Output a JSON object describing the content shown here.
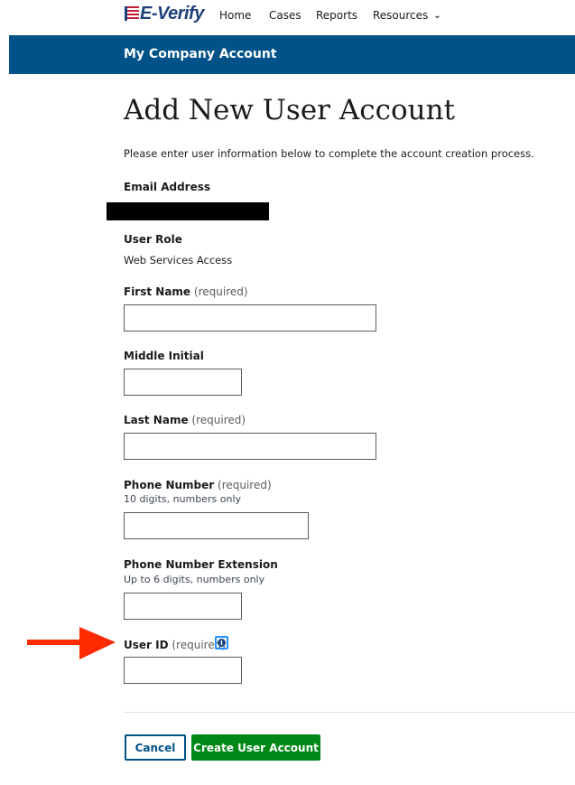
{
  "nav": {
    "logo_text": "E-Verify",
    "items": [
      "Home",
      "Cases",
      "Reports",
      "Resources"
    ]
  },
  "banner": {
    "title": "My Company Account"
  },
  "page": {
    "title": "Add New User Account",
    "intro": "Please enter user information below to complete the account creation process."
  },
  "form": {
    "required_text": "(required)",
    "email": {
      "label": "Email Address"
    },
    "user_role": {
      "label": "User Role",
      "value": "Web Services Access"
    },
    "first_name": {
      "label": "First Name",
      "value": ""
    },
    "middle_initial": {
      "label": "Middle Initial",
      "value": ""
    },
    "last_name": {
      "label": "Last Name",
      "value": ""
    },
    "phone": {
      "label": "Phone Number",
      "hint": "10 digits, numbers only",
      "value": ""
    },
    "phone_ext": {
      "label": "Phone Number Extension",
      "hint": "Up to 6 digits, numbers only",
      "value": ""
    },
    "user_id": {
      "label": "User ID",
      "value": "",
      "info_icon": "info-circle-icon"
    }
  },
  "actions": {
    "cancel_label": "Cancel",
    "create_label": "Create User Account"
  },
  "colors": {
    "banner": "#005288",
    "primary_button": "#008817",
    "cancel_outline": "#005288",
    "annotation_arrow": "#ff2a00",
    "info_focus": "#2491ff"
  }
}
